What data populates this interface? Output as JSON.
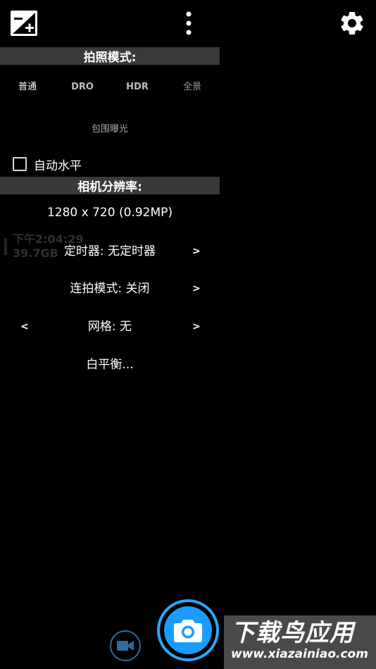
{
  "toolbar": {
    "exposure_icon": "exposure-plus-icon",
    "more_icon": "more-vertical-icon",
    "settings_icon": "gear-icon"
  },
  "photo_mode": {
    "title": "拍照模式:",
    "modes": [
      "普通",
      "DRO",
      "HDR",
      "全景"
    ],
    "selected": "普通",
    "bracketing": "包围曝光"
  },
  "auto_level": {
    "label": "自动水平",
    "checked": false
  },
  "resolution": {
    "title": "相机分辨率:",
    "value": "1280 x 720 (0.92MP)"
  },
  "background_overlay": {
    "time": "下午2:04:29",
    "storage": "39.7GB"
  },
  "settings": {
    "timer": "定时器: 无定时器",
    "burst": "连拍模式: 关闭",
    "grid": "网格: 无",
    "white_balance": "白平衡...",
    "arrow_right": ">",
    "arrow_left": "<"
  },
  "bottom": {
    "video_icon": "video-camera-icon",
    "shutter_icon": "camera-icon"
  },
  "watermark": {
    "title": "下载鸟应用",
    "url": "www.xiazainiao.com"
  },
  "colors": {
    "background": "#000000",
    "section_bar": "#3a3a3a",
    "accent": "#1a9cff",
    "watermark_bg": "#4a4a4a"
  }
}
